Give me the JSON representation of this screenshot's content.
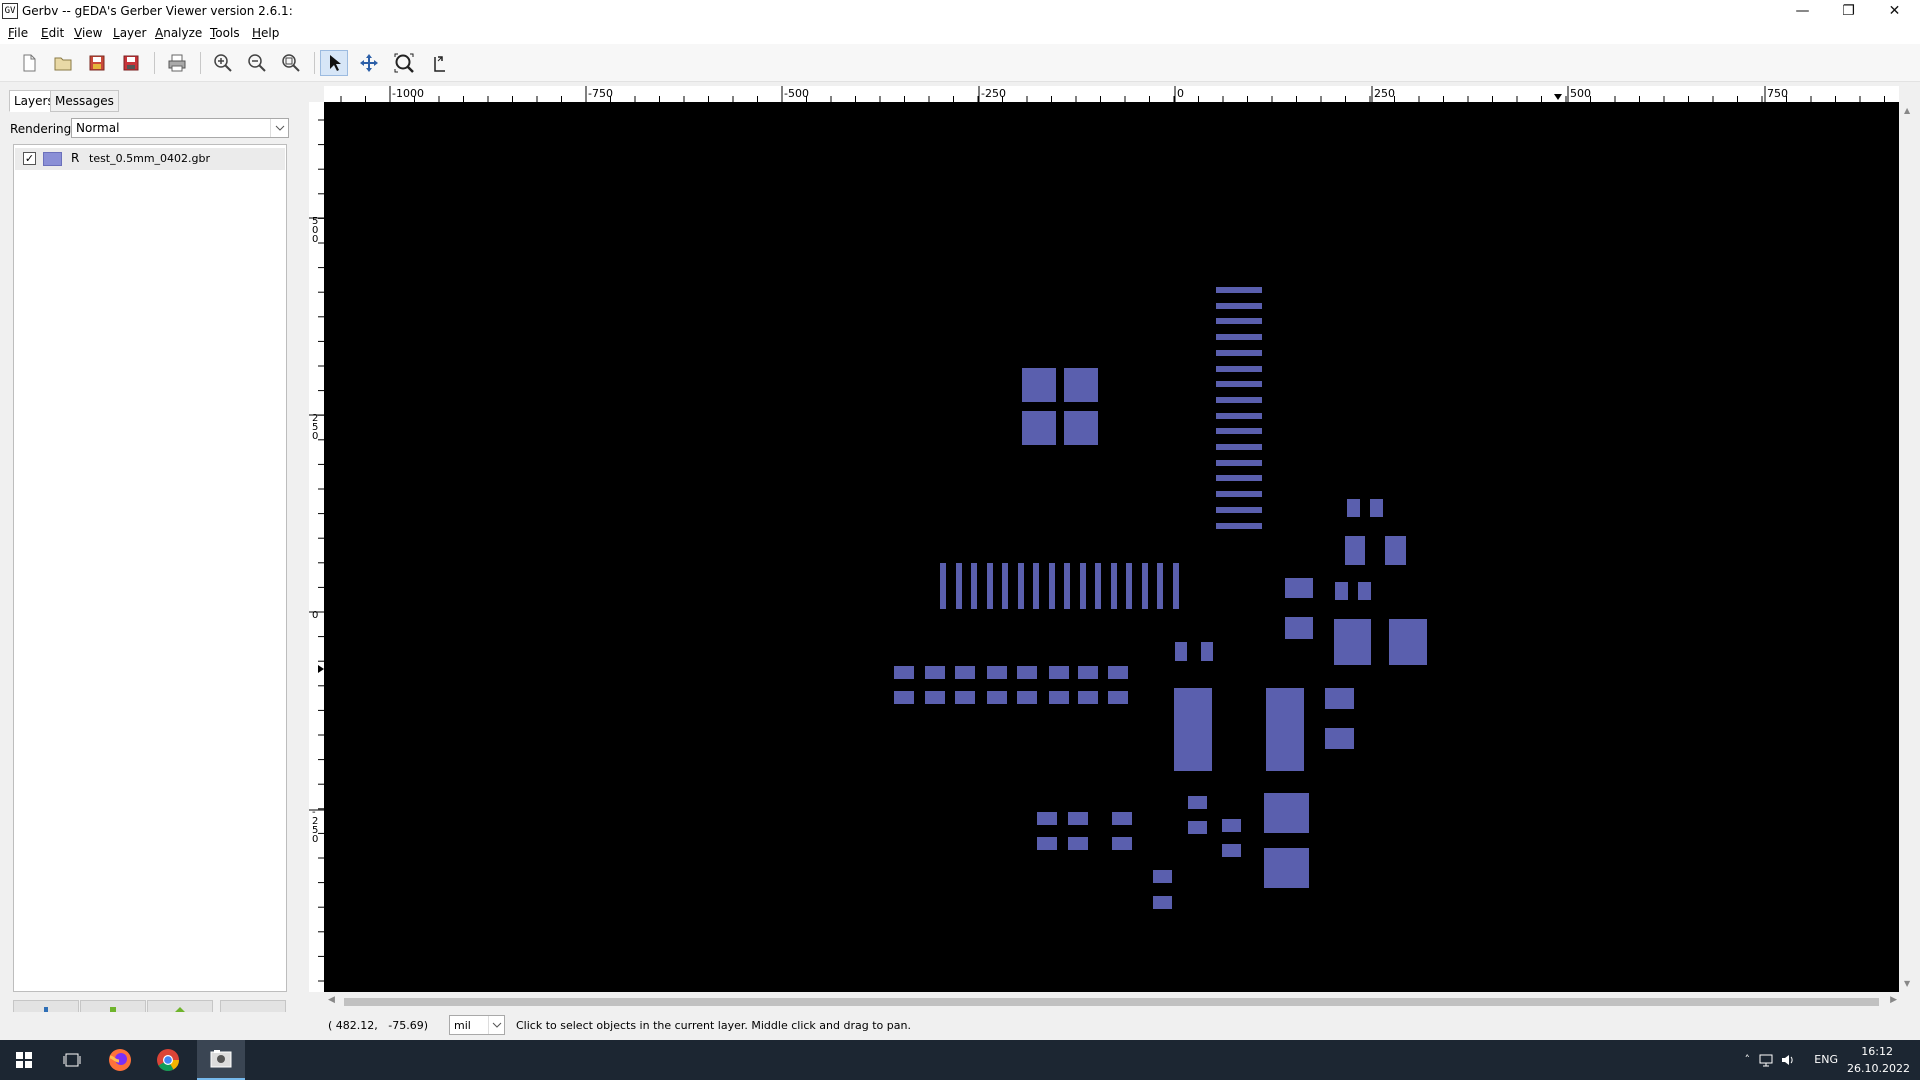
{
  "window": {
    "title": "Gerbv -- gEDA's Gerber Viewer version 2.6.1:",
    "icon_text": "GV",
    "controls": [
      "minimize-icon",
      "restore-icon",
      "close-icon"
    ]
  },
  "menu": [
    {
      "label": "File",
      "accel": "F"
    },
    {
      "label": "Edit",
      "accel": "E"
    },
    {
      "label": "View",
      "accel": "V"
    },
    {
      "label": "Layer",
      "accel": "L"
    },
    {
      "label": "Analyze",
      "accel": "A"
    },
    {
      "label": "Tools",
      "accel": "T"
    },
    {
      "label": "Help",
      "accel": "H"
    }
  ],
  "toolbar": {
    "buttons": [
      "new-project-icon",
      "open-icon",
      "save-icon",
      "save-as-icon",
      "print-icon",
      "zoom-in-icon",
      "zoom-out-icon",
      "zoom-fit-icon",
      "pointer-tool-icon",
      "pan-tool-icon",
      "zoom-tool-icon",
      "measure-tool-icon"
    ],
    "active_tool": "pointer-tool-icon"
  },
  "sidebar": {
    "tabs": [
      {
        "label": "Layers",
        "active": true
      },
      {
        "label": "Messages",
        "active": false
      }
    ],
    "rendering_label": "Rendering:",
    "rendering_value": "Normal",
    "layers": [
      {
        "visible": true,
        "color": "#8a8fd6",
        "flag": "R",
        "name": "test_0.5mm_0402.gbr"
      }
    ],
    "layer_buttons": [
      "add-layer-icon",
      "move-layer-down-icon",
      "move-layer-up-icon",
      "remove-layer-icon"
    ]
  },
  "ruler": {
    "horizontal_labels": [
      "-1000",
      "-750",
      "-500",
      "-250",
      "0",
      "250",
      "500",
      "750"
    ],
    "vertical_labels": [
      "500",
      "250",
      "0",
      "-250"
    ]
  },
  "canvas": {
    "background": "#000000",
    "pad_color": "#5a5fae"
  },
  "status": {
    "coordinates": "( 482.12,   -75.69)",
    "units": "mil",
    "message": "Click to select objects in the current layer. Middle click and drag to pan."
  },
  "taskbar": {
    "apps": [
      "windows-start-icon",
      "task-view-icon",
      "firefox-icon",
      "chrome-icon",
      "gerbv-app-icon"
    ],
    "tray_lang": "ENG",
    "time": "16:12",
    "date": "26.10.2022"
  }
}
